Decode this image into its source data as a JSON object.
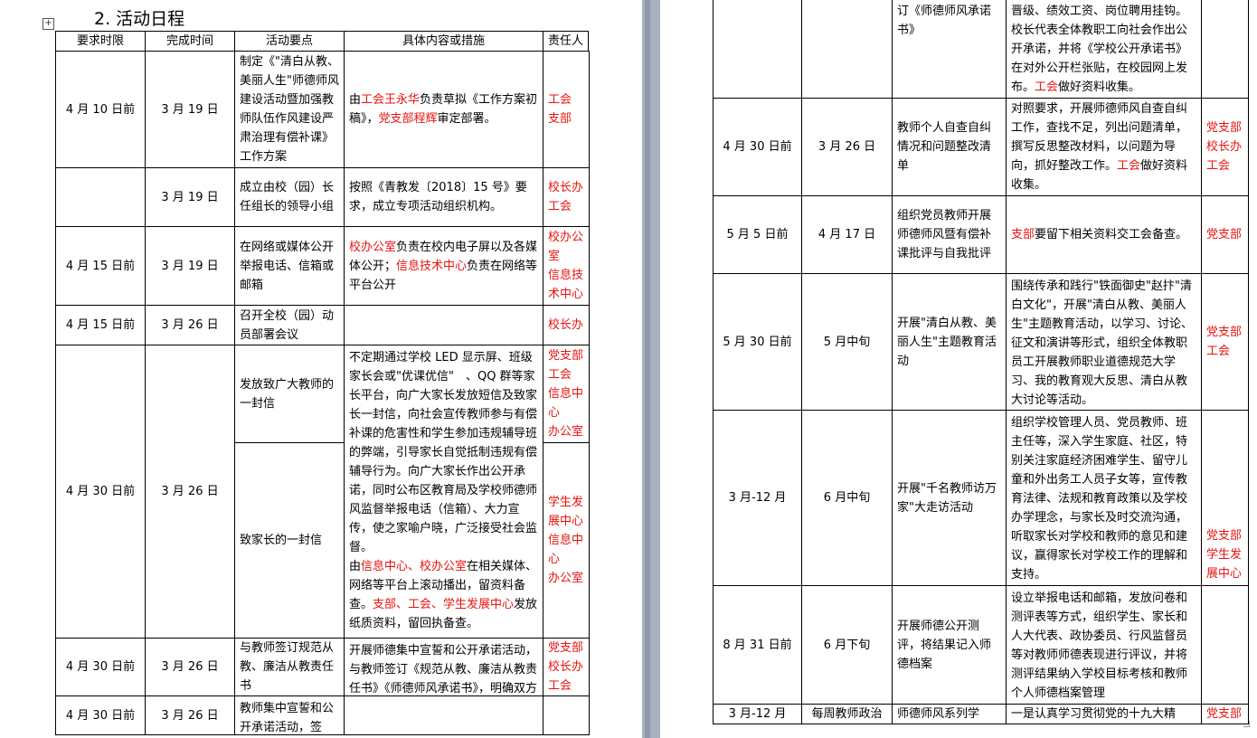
{
  "section_title": "2. 活动日程",
  "table_move_glyph": "+",
  "headers": [
    "要求时限",
    "完成时间",
    "活动要点",
    "具体内容或措施",
    "责任人"
  ],
  "left_rows": [
    {
      "deadline": "4 月 10 日前",
      "done": "3 月 19 日",
      "point": "制定《\"清白从教、美丽人生\"师德师风建设活动暨加强教师队伍作风建设严肃治理有偿补课》工作方案",
      "content": [
        {
          "t": "由",
          "r": false
        },
        {
          "t": "工会王永华",
          "r": true
        },
        {
          "t": "负责草拟《工作方案初稿》，",
          "r": false
        },
        {
          "t": "党支部程辉",
          "r": true
        },
        {
          "t": "审定部署。",
          "r": false
        }
      ],
      "resp": [
        "工会",
        "支部"
      ]
    },
    {
      "deadline": "",
      "done": "3 月 19 日",
      "point": "成立由校（园）长任组长的领导小组",
      "content": [
        {
          "t": "按照《青教发〔2018〕15 号》要求，成立专项活动组织机构。",
          "r": false
        }
      ],
      "resp": [
        "校长办",
        "工会"
      ]
    },
    {
      "deadline": "4 月 15 日前",
      "done": "3 月 19 日",
      "point": "在网络或媒体公开举报电话、信箱或邮箱",
      "content": [
        {
          "t": "校办公室",
          "r": true
        },
        {
          "t": "负责在校内电子屏以及各媒体公开；",
          "r": false
        },
        {
          "t": "信息技术中心",
          "r": true
        },
        {
          "t": "负责在网络等平台公开",
          "r": false
        }
      ],
      "resp": [
        "校办公",
        "室",
        "信息技",
        "术中心"
      ]
    },
    {
      "deadline": "4 月 15 日前",
      "done": "3 月 26 日",
      "point": "召开全校（园）动员部署会议",
      "content": [],
      "resp": [
        "校长办"
      ]
    },
    {
      "deadline": "4 月 30 日前",
      "done": "3 月 26 日",
      "point_a": "发放致广大教师的一封信",
      "point_b": "致家长的一封信",
      "content": [
        {
          "t": "不定期通过学校 LED 显示屏、班级家长会或\"优课优信\"　、QQ 群等家长平台，向广大家长发放短信及致家长一封信，向社会宣传教师参与有偿补课的危害性和学生参加违规辅导班的弊端，引导家长自觉抵制违规有偿辅导行为。向广大家长作出公开承诺，同时公布区教育局及学校师德师风监督举报电话（信箱）、大力宣传，使之家喻户晓，广泛接受社会监督。",
          "r": false
        },
        {
          "t": "\n由",
          "r": false
        },
        {
          "t": "信息中心、校办公室",
          "r": true
        },
        {
          "t": "在相关媒体、网络等平台上滚动播出，留资料备查。",
          "r": false
        },
        {
          "t": "支部、工会、学生发展中心",
          "r": true
        },
        {
          "t": "发放纸质资料，留回执备查。",
          "r": false
        }
      ],
      "resp_a": [
        "党支部",
        "工会",
        "信息中",
        "心",
        "办公室"
      ],
      "resp_b": [
        "学生发",
        "展中心",
        "信息中",
        "心",
        "办公室"
      ]
    },
    {
      "deadline": "4 月 30 日前",
      "done": "3 月 26 日",
      "point": "与教师签订规范从教、廉洁从教责任书",
      "content": [
        {
          "t": "开展师德集中宣誓和公开承诺活动，与教师签订《规范从教、廉洁从教责任书》《师德师风承诺书》，明确双方权利义务，逐条列明违规惩处措施，与教师考核评价、评优",
          "r": false
        }
      ],
      "resp": [
        "党支部",
        "校长办",
        "工会"
      ]
    },
    {
      "deadline": "4 月 30 日前",
      "done": "3 月 26 日",
      "point": "教师集中宣誓和公开承诺活动，签",
      "content": [],
      "resp": []
    }
  ],
  "right_rows": [
    {
      "deadline": "",
      "done": "",
      "point": "订《师德师风承诺书》",
      "content": [
        {
          "t": "晋级、绩效工资、岗位聘用挂钩。校长代表全体教职工向社会作出公开承诺，并将《学校公开承诺书》在对外公开栏张贴，在校园网上发布。",
          "r": false
        },
        {
          "t": "工会",
          "r": true
        },
        {
          "t": "做好资料收集。",
          "r": false
        }
      ],
      "resp": []
    },
    {
      "deadline": "4 月 30 日前",
      "done": "3 月 26 日",
      "point": "教师个人自查自纠情况和问题整改清单",
      "content": [
        {
          "t": "对照要求，开展师德师风自查自纠工作，查找不足，列出问题清单，撰写反思整改材料，以问题为导向，抓好整改工作。",
          "r": false
        },
        {
          "t": "工会",
          "r": true
        },
        {
          "t": "做好资料收集。",
          "r": false
        }
      ],
      "resp": [
        "党支部",
        "校长办",
        "工会"
      ]
    },
    {
      "deadline": "5 月 5 日前",
      "done": "4 月 17 日",
      "point": "组织党员教师开展师德师风暨有偿补课批评与自我批评",
      "content": [
        {
          "t": "支部",
          "r": true
        },
        {
          "t": "要留下相关资料交工会备查。",
          "r": false
        }
      ],
      "resp": [
        "党支部"
      ]
    },
    {
      "deadline": "5 月 30 日前",
      "done": "5 月中旬",
      "point": "开展\"清白从教、美丽人生\"主题教育活动",
      "content": [
        {
          "t": "围绕传承和践行\"铁面御史\"赵抃\"清白文化\"，开展\"清白从教、美丽人生\"主题教育活动，以学习、讨论、征文和演讲等形式，组织全体教职员工开展教师职业道德规范大学习、我的教育观大反思、清白从教大讨论等活动。",
          "r": false
        }
      ],
      "resp": [
        "党支部",
        "工会"
      ]
    },
    {
      "deadline": "3 月-12 月",
      "done": "6 月中旬",
      "point": "开展\"千名教师访万家\"大走访活动",
      "content": [
        {
          "t": "组织学校管理人员、党员教师、班主任等，深入学生家庭、社区，特别关注家庭经济困难学生、留守儿童和外出务工人员子女等，宣传教育法律、法规和教育政策以及学校办学理念，与家长及时交流沟通，听取家长对学校和教师的意见和建议，赢得家长对学校工作的理解和支持。",
          "r": false
        }
      ],
      "resp": [
        "党支部",
        "学生发",
        "展中心"
      ]
    },
    {
      "deadline": "8 月 31 日前",
      "done": "6 月下旬",
      "point": "开展师德公开测评，将结果记入师德档案",
      "content": [
        {
          "t": "设立举报电话和邮箱，发放问卷和测评表等方式，组织学生、家长和人大代表、政协委员、行风监督员等对教师师德表现进行评议，并将测评结果纳入学校目标考核和教师个人师德档案管理",
          "r": false
        }
      ],
      "resp": []
    },
    {
      "deadline": "3 月-12 月",
      "done": "每周教师政治",
      "point": "师德师风系列学",
      "content": [
        {
          "t": "一是认真学习贯彻党的十九大精",
          "r": false
        }
      ],
      "resp": [
        "党支部"
      ]
    }
  ]
}
